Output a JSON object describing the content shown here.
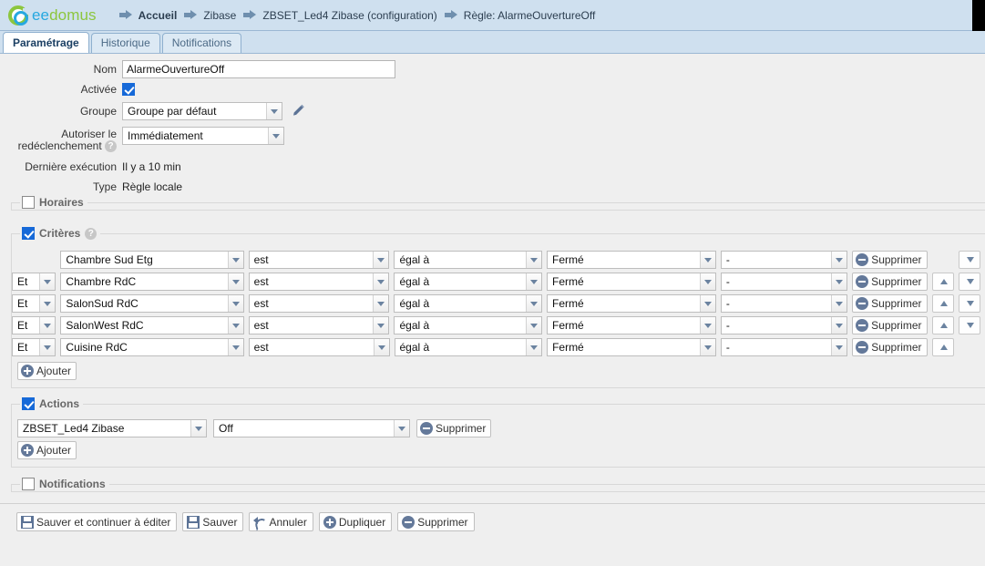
{
  "header": {
    "logo": {
      "part1": "ee",
      "part2": "domus",
      "icon": "eedomus-ring-logo"
    },
    "breadcrumb": [
      {
        "label": "Accueil",
        "bold": true
      },
      {
        "label": "Zibase",
        "bold": false
      },
      {
        "label": "ZBSET_Led4 Zibase (configuration)",
        "bold": false
      },
      {
        "label": "Règle: AlarmeOuvertureOff",
        "bold": false
      }
    ]
  },
  "tabs": [
    {
      "label": "Paramétrage",
      "active": true
    },
    {
      "label": "Historique",
      "active": false
    },
    {
      "label": "Notifications",
      "active": false
    }
  ],
  "form": {
    "nom_label": "Nom",
    "nom_value": "AlarmeOuvertureOff",
    "activee_label": "Activée",
    "activee_checked": true,
    "groupe_label": "Groupe",
    "groupe_value": "Groupe par défaut",
    "retrigger_label_line1": "Autoriser le",
    "retrigger_label_line2": "redéclenchement",
    "retrigger_value": "Immédiatement",
    "help_glyph": "?",
    "last_exec_label": "Dernière exécution",
    "last_exec_value": "Il y a 10 min",
    "type_label": "Type",
    "type_value": "Règle locale"
  },
  "sections": {
    "horaires": {
      "legend": "Horaires",
      "checked": false
    },
    "criteres": {
      "legend": "Critères",
      "checked": true,
      "has_help": true
    },
    "actions": {
      "legend": "Actions",
      "checked": true
    },
    "notifications": {
      "legend": "Notifications",
      "checked": false
    }
  },
  "criteria": {
    "rows": [
      {
        "connector": "",
        "device": "Chambre Sud Etg",
        "operator": "est",
        "comparator": "égal à",
        "value": "Fermé",
        "extra": "-",
        "delete_label": "Supprimer",
        "up": false,
        "down": true
      },
      {
        "connector": "Et",
        "device": "Chambre RdC",
        "operator": "est",
        "comparator": "égal à",
        "value": "Fermé",
        "extra": "-",
        "delete_label": "Supprimer",
        "up": true,
        "down": true
      },
      {
        "connector": "Et",
        "device": "SalonSud RdC",
        "operator": "est",
        "comparator": "égal à",
        "value": "Fermé",
        "extra": "-",
        "delete_label": "Supprimer",
        "up": true,
        "down": true
      },
      {
        "connector": "Et",
        "device": "SalonWest RdC",
        "operator": "est",
        "comparator": "égal à",
        "value": "Fermé",
        "extra": "-",
        "delete_label": "Supprimer",
        "up": true,
        "down": true
      },
      {
        "connector": "Et",
        "device": "Cuisine RdC",
        "operator": "est",
        "comparator": "égal à",
        "value": "Fermé",
        "extra": "-",
        "delete_label": "Supprimer",
        "up": true,
        "down": false
      }
    ],
    "add_label": "Ajouter"
  },
  "actions": {
    "rows": [
      {
        "device": "ZBSET_Led4 Zibase",
        "value": "Off",
        "delete_label": "Supprimer"
      }
    ],
    "add_label": "Ajouter"
  },
  "footer": {
    "save_continue": "Sauver et continuer à éditer",
    "save": "Sauver",
    "cancel": "Annuler",
    "duplicate": "Dupliquer",
    "delete": "Supprimer"
  },
  "colors": {
    "header_bg": "#cfe0ef",
    "page_bg": "#efefef",
    "accent_blue": "#27a8e0",
    "accent_green": "#8cc63e",
    "checkbox_blue": "#1669d8",
    "icon_slate": "#64799a"
  }
}
